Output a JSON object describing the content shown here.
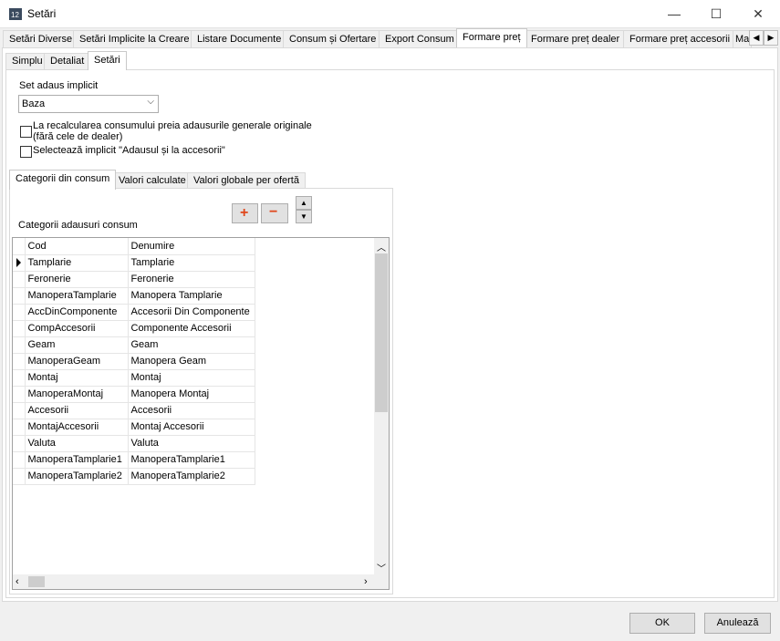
{
  "window": {
    "title": "Setări",
    "minimize_glyph": "—",
    "maximize_glyph": "☐",
    "close_glyph": "✕",
    "icon": "app-logo-icon"
  },
  "outer_tabs": [
    {
      "label": "Setări Diverse"
    },
    {
      "label": "Setări Implicite la Creare"
    },
    {
      "label": "Listare Documente"
    },
    {
      "label": "Consum și Ofertare"
    },
    {
      "label": "Export Consum"
    },
    {
      "label": "Formare preț"
    },
    {
      "label": "Formare preț dealer"
    },
    {
      "label": "Formare preț accesorii"
    },
    {
      "label": "Ma"
    }
  ],
  "outer_tabs_active": "Formare preț",
  "sub_tabs": [
    {
      "label": "Simplu"
    },
    {
      "label": "Detaliat"
    },
    {
      "label": "Setări"
    }
  ],
  "settings": {
    "set_label": "Set adaus implicit",
    "set_value": "Baza",
    "checkbox1_line1": "La recalcularea consumului preia adausurile generale originale",
    "checkbox1_line2": "(fără cele de dealer)",
    "checkbox1_checked": false,
    "checkbox2_label": "Selectează implicit \"Adausul și la accesorii\"",
    "checkbox2_checked": false
  },
  "inner_tabs": [
    {
      "label": "Categorii din consum"
    },
    {
      "label": "Valori calculate"
    },
    {
      "label": "Valori globale per ofertă"
    }
  ],
  "categories": {
    "title": "Categorii adausuri consum",
    "add_glyph": "+",
    "remove_glyph": "−",
    "columns": [
      "Cod",
      "Denumire"
    ],
    "rows": [
      [
        "Tamplarie",
        "Tamplarie"
      ],
      [
        "Feronerie",
        "Feronerie"
      ],
      [
        "ManoperaTamplarie",
        "Manopera Tamplarie"
      ],
      [
        "AccDinComponente",
        "Accesorii Din Componente"
      ],
      [
        "CompAccesorii",
        "Componente Accesorii"
      ],
      [
        "Geam",
        "Geam"
      ],
      [
        "ManoperaGeam",
        "Manopera Geam"
      ],
      [
        "Montaj",
        "Montaj"
      ],
      [
        "ManoperaMontaj",
        "Manopera Montaj"
      ],
      [
        "Accesorii",
        "Accesorii"
      ],
      [
        "MontajAccesorii",
        "Montaj Accesorii"
      ],
      [
        "Valuta",
        "Valuta"
      ],
      [
        "ManoperaTamplarie1",
        "ManoperaTamplarie1"
      ],
      [
        "ManoperaTamplarie2",
        "ManoperaTamplarie2"
      ]
    ],
    "current_row": 0
  },
  "footer": {
    "ok_label": "OK",
    "cancel_label": "Anulează"
  },
  "colors": {
    "add_icon": "#e0461a",
    "remove_icon": "#e0461a",
    "window_bg": "#f0f0f0"
  }
}
